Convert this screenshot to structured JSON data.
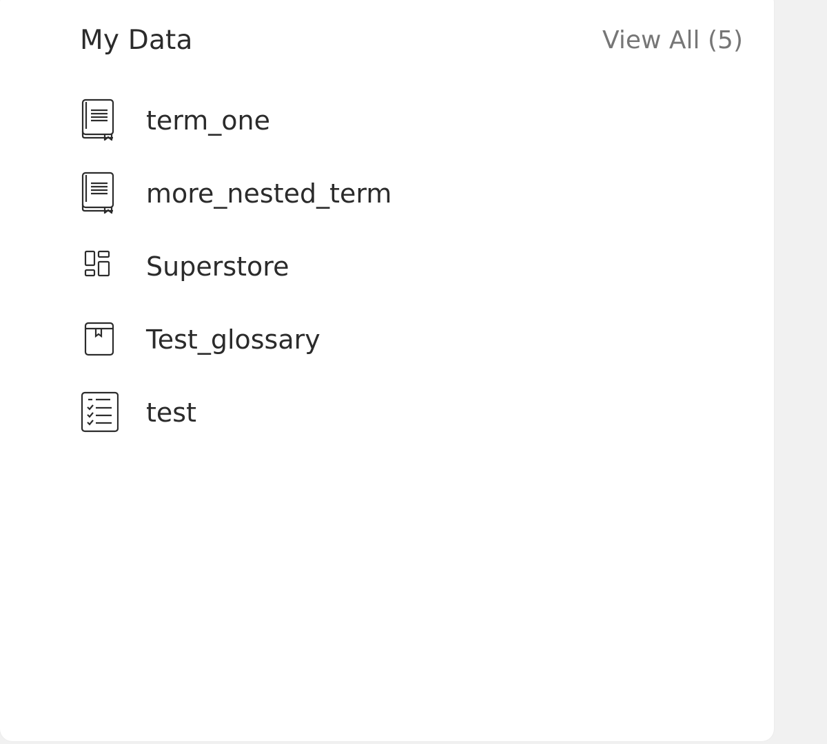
{
  "widget": {
    "title": "My Data",
    "view_all": "View All (5)"
  },
  "items": [
    {
      "label": "term_one",
      "icon": "glossary-term-icon"
    },
    {
      "label": "more_nested_term",
      "icon": "glossary-term-icon"
    },
    {
      "label": "Superstore",
      "icon": "dashboard-icon"
    },
    {
      "label": "Test_glossary",
      "icon": "glossary-icon"
    },
    {
      "label": "test",
      "icon": "checklist-icon"
    }
  ]
}
